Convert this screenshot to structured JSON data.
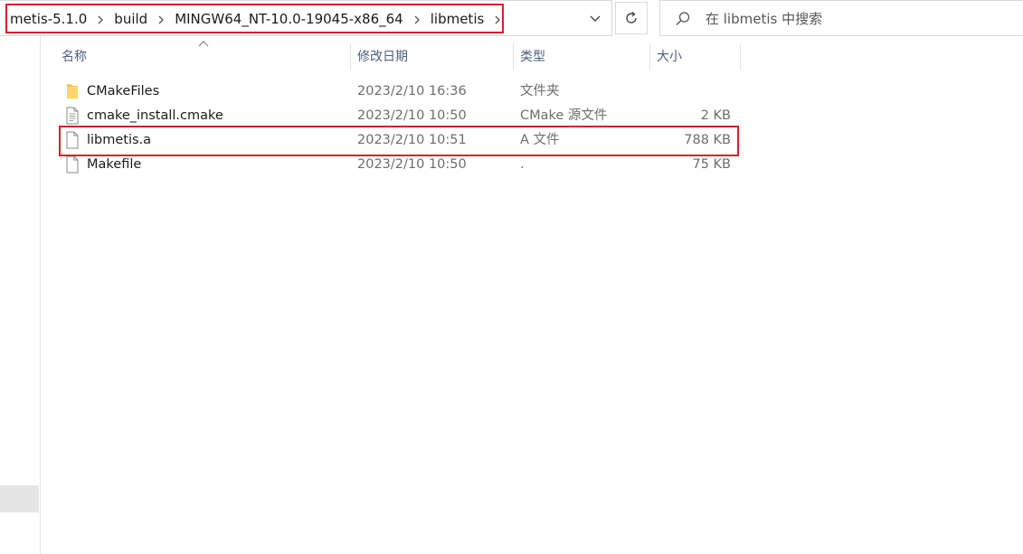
{
  "address_bar": {
    "crumbs": [
      "metis-5.1.0",
      "build",
      "MINGW64_NT-10.0-19045-x86_64",
      "libmetis"
    ]
  },
  "search": {
    "placeholder": "在 libmetis 中搜索"
  },
  "columns": {
    "name": "名称",
    "date": "修改日期",
    "type": "类型",
    "size": "大小"
  },
  "files": [
    {
      "name": "CMakeFiles",
      "date": "2023/2/10 16:36",
      "type": "文件夹",
      "size": "",
      "icon": "folder-icon"
    },
    {
      "name": "cmake_install.cmake",
      "date": "2023/2/10 10:50",
      "type": "CMake 源文件",
      "size": "2 KB",
      "icon": "text-file-icon"
    },
    {
      "name": "libmetis.a",
      "date": "2023/2/10 10:51",
      "type": "A 文件",
      "size": "788 KB",
      "icon": "file-icon"
    },
    {
      "name": "Makefile",
      "date": "2023/2/10 10:50",
      "type": ".",
      "size": "75 KB",
      "icon": "file-icon"
    }
  ],
  "colors": {
    "highlight": "#d9202c",
    "folder": "#f4c44e"
  }
}
